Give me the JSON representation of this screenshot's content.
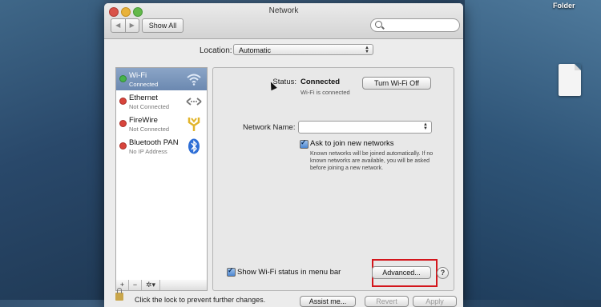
{
  "desktop": {
    "folder_label": "Folder"
  },
  "window": {
    "title": "Network",
    "nav_back": "◀",
    "nav_forward": "▶",
    "show_all": "Show All",
    "search_placeholder": ""
  },
  "location": {
    "label": "Location:",
    "value": "Automatic"
  },
  "services": [
    {
      "name": "Wi-Fi",
      "status": "Connected",
      "state": "green",
      "icon": "wifi-icon",
      "selected": true
    },
    {
      "name": "Ethernet",
      "status": "Not Connected",
      "state": "red",
      "icon": "ethernet-icon",
      "selected": false
    },
    {
      "name": "FireWire",
      "status": "Not Connected",
      "state": "red",
      "icon": "firewire-icon",
      "selected": false
    },
    {
      "name": "Bluetooth PAN",
      "status": "No IP Address",
      "state": "red",
      "icon": "bluetooth-icon",
      "selected": false
    }
  ],
  "sidebar_controls": {
    "add": "+",
    "remove": "−",
    "action": "✲▾"
  },
  "detail": {
    "status_label": "Status:",
    "status_value": "Connected",
    "status_sub": "Wi-Fi is connected",
    "turn_off_button": "Turn Wi-Fi Off",
    "network_name_label": "Network Name:",
    "network_name_value": "",
    "ask_join_label": "Ask to join new networks",
    "ask_join_checked": true,
    "ask_join_desc": "Known networks will be joined automatically. If no known networks are available, you will be asked before joining a new network.",
    "menu_status_label": "Show Wi-Fi status in menu bar",
    "menu_status_checked": true,
    "advanced_button": "Advanced...",
    "help_button": "?"
  },
  "footer": {
    "lock_text": "Click the lock to prevent further changes.",
    "assist_button": "Assist me...",
    "revert_button": "Revert",
    "apply_button": "Apply"
  },
  "colors": {
    "selection": "#6b88b0",
    "status_green": "#47b34a",
    "status_red": "#d8443c",
    "highlight_box": "#d3161c"
  }
}
